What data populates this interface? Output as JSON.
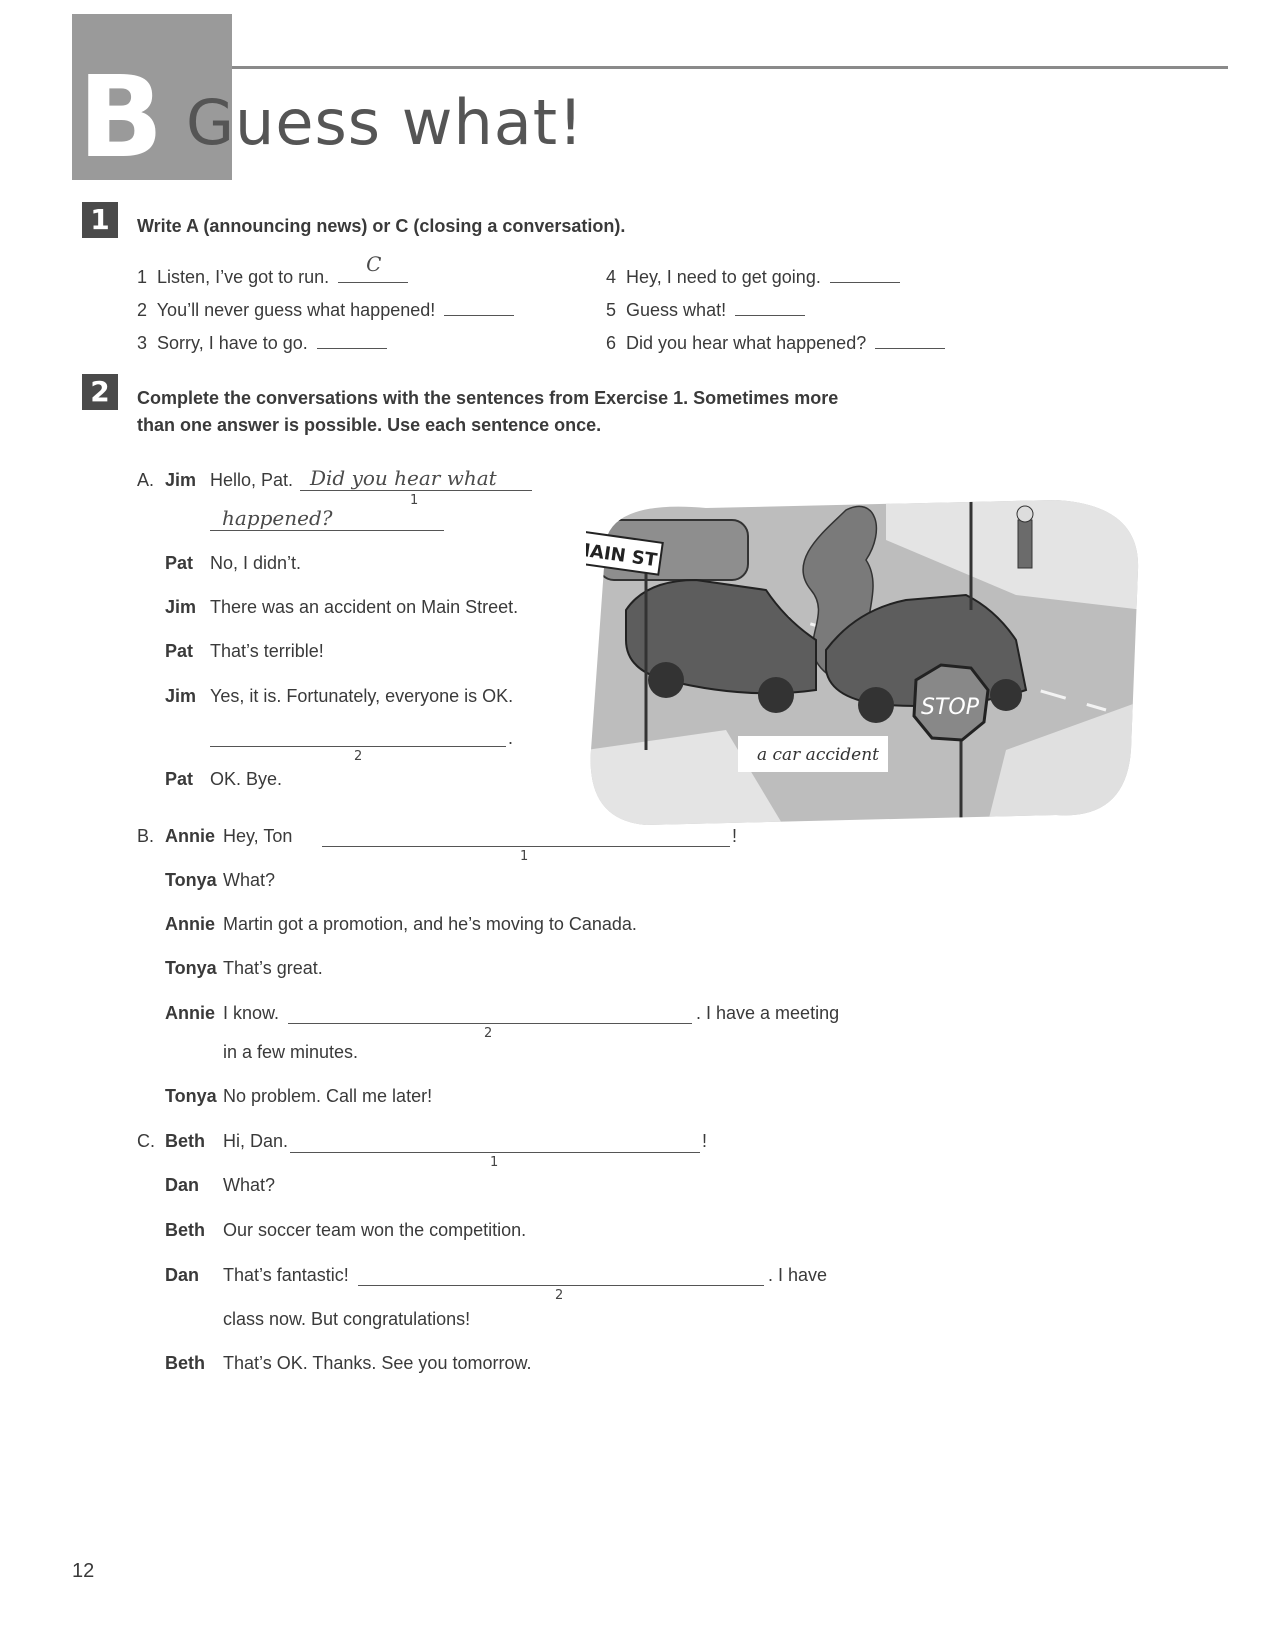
{
  "header": {
    "letter": "B",
    "title": "Guess what!"
  },
  "exercise1": {
    "number": "1",
    "instruction": "Write A (announcing news) or C (closing a conversation).",
    "items": [
      {
        "num": "1",
        "text": "Listen, I’ve got to run.",
        "answer": "C"
      },
      {
        "num": "2",
        "text": "You’ll never guess what happened!",
        "answer": ""
      },
      {
        "num": "3",
        "text": "Sorry, I have to go.",
        "answer": ""
      },
      {
        "num": "4",
        "text": "Hey, I need to get going.",
        "answer": ""
      },
      {
        "num": "5",
        "text": "Guess what!",
        "answer": ""
      },
      {
        "num": "6",
        "text": "Did you hear what happened?",
        "answer": ""
      }
    ]
  },
  "exercise2": {
    "number": "2",
    "instruction_line1": "Complete the conversations with the sentences from Exercise 1. Sometimes more",
    "instruction_line2": "than one answer is possible. Use each sentence once.",
    "convA": {
      "label": "A.",
      "lines": [
        {
          "speaker": "Jim",
          "text": "Hello, Pat."
        },
        {
          "speaker": "Pat",
          "text": "No, I didn’t."
        },
        {
          "speaker": "Jim",
          "text": "There was an accident on Main Street."
        },
        {
          "speaker": "Pat",
          "text": "That’s terrible!"
        },
        {
          "speaker": "Jim",
          "text": "Yes, it is. Fortunately, everyone is OK."
        },
        {
          "speaker": "Pat",
          "text": "OK. Bye."
        }
      ],
      "handwritten_1a": "Did you hear what",
      "handwritten_1b": "happened?",
      "blank1_num": "1",
      "blank2_num": "2",
      "blank2_end": "."
    },
    "convB": {
      "label": "B.",
      "lines": [
        {
          "speaker": "Annie",
          "text": "Hey, Ton"
        },
        {
          "speaker": "Tonya",
          "text": "What?"
        },
        {
          "speaker": "Annie",
          "text": "Martin got a promotion, and he’s moving to Canada."
        },
        {
          "speaker": "Tonya",
          "text": "That’s great."
        },
        {
          "speaker": "Annie",
          "text": "I know."
        },
        {
          "speaker": "Tonya",
          "text": "No problem. Call me later!"
        }
      ],
      "blank1_end": "!",
      "blank1_num": "1",
      "blank2_end": ". I have a meeting",
      "blank2_cont": "in a few minutes.",
      "blank2_num": "2"
    },
    "convC": {
      "label": "C.",
      "lines": [
        {
          "speaker": "Beth",
          "text": "Hi, Dan."
        },
        {
          "speaker": "Dan",
          "text": "What?"
        },
        {
          "speaker": "Beth",
          "text": "Our soccer team won the competition."
        },
        {
          "speaker": "Dan",
          "text": "That’s fantastic!"
        },
        {
          "speaker": "Beth",
          "text": "That’s OK. Thanks. See you tomorrow."
        }
      ],
      "blank1_end": "!",
      "blank1_num": "1",
      "blank2_end": ". I have",
      "blank2_cont": "class now. But congratulations!",
      "blank2_num": "2"
    }
  },
  "illustration": {
    "caption": "a car accident",
    "street_sign": "MAIN ST",
    "stop_sign": "STOP"
  },
  "page_number": "12"
}
